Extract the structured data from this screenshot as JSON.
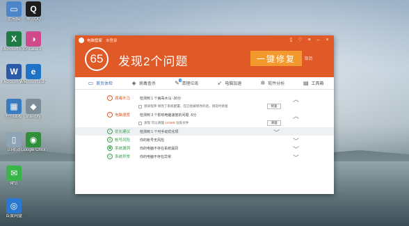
{
  "desktop": {
    "icons": [
      {
        "label": "此电脑",
        "glyph": "▭",
        "color": "#4a86c8"
      },
      {
        "label": "腾讯QQ",
        "glyph": "Q",
        "color": "#1d1d1d"
      },
      {
        "label": "Microsoft Excel",
        "glyph": "X",
        "color": "#1f7a44"
      },
      {
        "label": "Picasa 3",
        "glyph": "◑",
        "color": "#d04a8b"
      },
      {
        "label": "Microsoft Word",
        "glyph": "W",
        "color": "#2a5aa8"
      },
      {
        "label": "Microsoft Edge",
        "glyph": "e",
        "color": "#1e73c7"
      },
      {
        "label": "控制面板",
        "glyph": "▦",
        "color": "#3a7bc0"
      },
      {
        "label": "Intercity",
        "glyph": "◆",
        "color": "#7d8d9a"
      },
      {
        "label": "回收站",
        "glyph": "▯",
        "color": "#8ea3b5"
      },
      {
        "label": "Google Chrome",
        "glyph": "◉",
        "color": "#2f8f3a"
      },
      {
        "label": "微信",
        "glyph": "✉",
        "color": "#3ab54a"
      },
      {
        "label": "百度网盘",
        "glyph": "◎",
        "color": "#2a78d1"
      }
    ]
  },
  "window": {
    "app_title": "电脑管家",
    "user_status": "未登录",
    "controls": [
      "▯",
      "♡",
      "≡",
      "–",
      "×"
    ],
    "score": "65",
    "headline": "发现2个问题",
    "fix_button": "一键修复",
    "cancel_link": "取消",
    "accent_color": "#e05a27",
    "tabs": [
      {
        "label": "首页体检",
        "icon": "monitor-icon",
        "glyph": "▭",
        "active": true
      },
      {
        "label": "病毒查杀",
        "icon": "shield-icon",
        "glyph": "◈",
        "active": false
      },
      {
        "label": "清理垃圾",
        "icon": "broom-icon",
        "glyph": "✎",
        "active": false,
        "badge": "1"
      },
      {
        "label": "电脑加速",
        "icon": "rocket-icon",
        "glyph": "➶",
        "active": false
      },
      {
        "label": "软件分析",
        "icon": "gear-icon",
        "glyph": "✲",
        "active": false
      },
      {
        "label": "工具箱",
        "icon": "toolbox-icon",
        "glyph": "▤",
        "active": false
      }
    ],
    "results": [
      {
        "name": "病毒木马",
        "desc": "检测到 1 个病毒木马 -30分",
        "status": "red",
        "glyph": "!",
        "sub": {
          "text": "感染程序 修改了系统配置，在已经被修改的话，请及时修复",
          "highlight": "",
          "button": "修复"
        }
      },
      {
        "name": "电脑速度",
        "desc": "检测到 3 个影响电脑速度的问题 -5分",
        "status": "red",
        "glyph": "!",
        "sub": {
          "text": "发现 可以清理 ",
          "highlight": "143MB",
          "text_after": " 垃圾文件",
          "button": "清理"
        }
      },
      {
        "name": "优化建议",
        "desc": "检测到 1 个可手动优化项",
        "status": "green",
        "glyph": "✓",
        "band": true
      },
      {
        "name": "帐号风险",
        "desc": "你的帐号无风险",
        "status": "green",
        "glyph": "♙"
      },
      {
        "name": "系统漏洞",
        "desc": "你的电脑不存在系统漏洞",
        "status": "green",
        "glyph": "▣"
      },
      {
        "name": "系统异常",
        "desc": "你的电脑不存在异常",
        "status": "green",
        "glyph": "▭"
      }
    ]
  }
}
